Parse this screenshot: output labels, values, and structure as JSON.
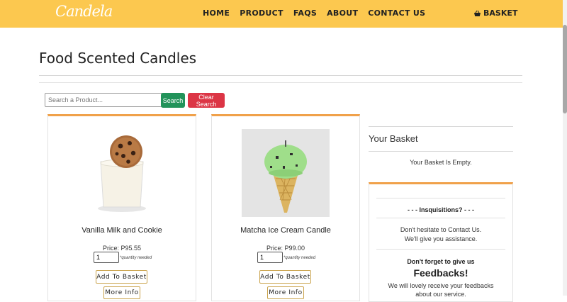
{
  "brand": {
    "logo_text": "Candela"
  },
  "nav": {
    "links": [
      "HOME",
      "PRODUCT",
      "FAQS",
      "ABOUT",
      "CONTACT US"
    ],
    "basket_label": "BASKET"
  },
  "page": {
    "title": "Food Scented Candles"
  },
  "search": {
    "placeholder": "Search a Product...",
    "search_label": "Search",
    "clear_label": "Clear Search"
  },
  "products": [
    {
      "name": "Vanilla Milk and Cookie",
      "price": "Price: P95.55",
      "quantity": "1",
      "quantity_note": "*quantity needed",
      "add_label": "Add To Basket",
      "info_label": "More Info"
    },
    {
      "name": "Matcha Ice Cream Candle",
      "price": "Price: P99.00",
      "quantity": "1",
      "quantity_note": "*quantity needed",
      "add_label": "Add To Basket",
      "info_label": "More Info"
    }
  ],
  "basket": {
    "title": "Your Basket",
    "empty_text": "Your Basket Is Empty."
  },
  "inquiry": {
    "title": "- - - Insquisitions? - - -",
    "line1": "Don't hesitate to Contact Us.",
    "line2": "We'll give you assistance.",
    "feedback_label": "Don't forget to give us",
    "feedback_title": "Feedbacks!",
    "feedback_line1": "We will lovely receive your feedbacks",
    "feedback_line2": "about our service."
  },
  "colors": {
    "navbar": "#fcc84f",
    "card_accent": "#f0a14a",
    "search_button": "#22935a",
    "clear_button": "#dc3545"
  }
}
